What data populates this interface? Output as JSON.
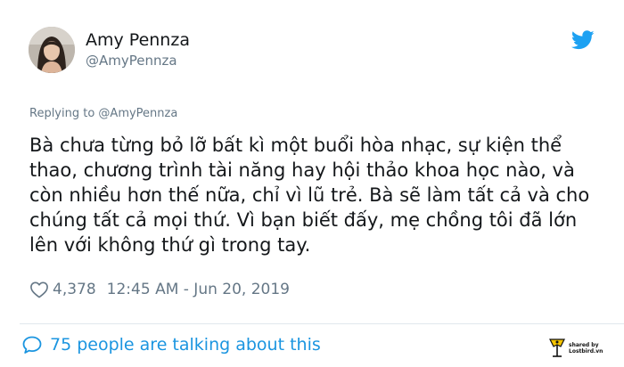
{
  "user": {
    "name": "Amy Pennza",
    "handle": "@AmyPennza"
  },
  "tweet": {
    "replying_to": "Replying to @AmyPennza",
    "text": "Bà chưa từng bỏ lỡ bất kì một buổi hòa nhạc, sự kiện thể thao, chương trình tài năng hay hội thảo khoa học nào, và còn nhiều hơn thế nữa, chỉ vì lũ trẻ. Bà sẽ làm tất cả và cho chúng tất cả mọi thứ. Vì bạn biết đấy, mẹ chồng tôi đã lớn lên với không thứ gì trong tay.",
    "likes": "4,378",
    "timestamp": "12:45 AM - Jun 20, 2019",
    "talking": "75 people are talking about this"
  },
  "watermark": {
    "line1": "shared by",
    "line2": "Lostbird.vn"
  },
  "colors": {
    "accent": "#1b95e0",
    "twitter_blue": "#1da1f2",
    "muted": "#657786",
    "text": "#14171a",
    "divider": "#e1e8ed"
  },
  "icons": [
    "avatar",
    "twitter-bird-icon",
    "heart-icon",
    "speech-bubble-icon",
    "lostbird-logo"
  ]
}
